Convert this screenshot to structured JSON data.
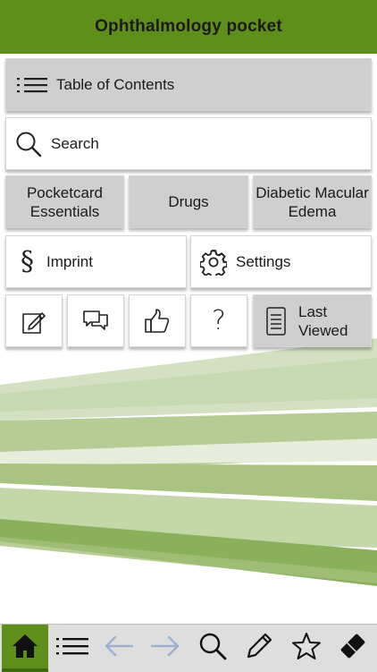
{
  "header": {
    "title": "Ophthalmology pocket"
  },
  "menu": {
    "toc_label": "Table of Contents",
    "search_label": "Search",
    "pocketcard_label": "Pocketcard Essentials",
    "drugs_label": "Drugs",
    "dme_label": "Diabetic Macular Edema",
    "imprint_label": "Imprint",
    "settings_label": "Settings",
    "last_viewed_label": "Last Viewed"
  },
  "quick_icons": [
    "notes-edit-icon",
    "feedback-chat-icon",
    "thumbs-up-icon",
    "help-icon"
  ],
  "tabbar": {
    "items": [
      "home-icon",
      "list-icon",
      "back-arrow-icon",
      "forward-arrow-icon",
      "search-icon",
      "pencil-icon",
      "star-icon",
      "eraser-icon"
    ],
    "active": "home"
  },
  "colors": {
    "brand_green": "#5f8f1b",
    "tile_grey": "#cfcfcf",
    "tabbar_grey": "#dedede",
    "disabled_arrow": "#9bb1d4"
  }
}
